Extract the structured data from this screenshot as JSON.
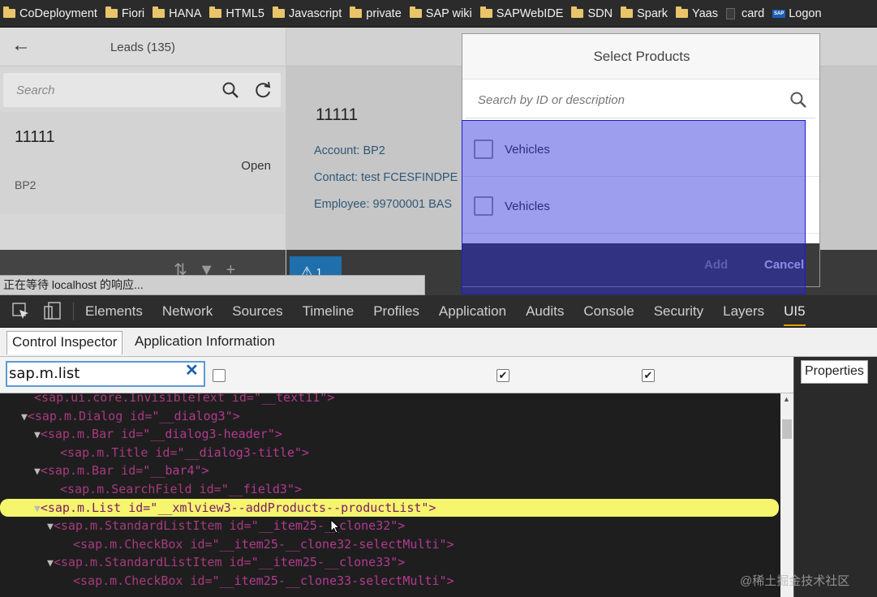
{
  "bookmarks": [
    {
      "label": "CoDeployment",
      "icon": "folder-icon"
    },
    {
      "label": "Fiori",
      "icon": "folder-icon"
    },
    {
      "label": "HANA",
      "icon": "folder-icon"
    },
    {
      "label": "HTML5",
      "icon": "folder-icon"
    },
    {
      "label": "Javascript",
      "icon": "folder-icon"
    },
    {
      "label": "private",
      "icon": "folder-icon"
    },
    {
      "label": "SAP wiki",
      "icon": "folder-icon"
    },
    {
      "label": "SAPWebIDE",
      "icon": "folder-icon"
    },
    {
      "label": "SDN",
      "icon": "folder-icon"
    },
    {
      "label": "Spark",
      "icon": "folder-icon"
    },
    {
      "label": "Yaas",
      "icon": "folder-icon"
    },
    {
      "label": "card",
      "icon": "page-icon"
    },
    {
      "label": "Logon",
      "icon": "sap-icon"
    }
  ],
  "master": {
    "title": "Leads (135)",
    "search_placeholder": "Search",
    "item": {
      "id": "11111",
      "status": "Open",
      "account": "BP2"
    }
  },
  "detail": {
    "id": "11111",
    "account": "Account: BP2",
    "contact": "Contact: test FCESFINDPE",
    "employee": "Employee: 99700001 BAS",
    "warn_count": "1"
  },
  "dialog": {
    "title": "Select Products",
    "search_placeholder": "Search by ID or description",
    "items": [
      {
        "label": "Vehicles"
      },
      {
        "label": "Vehicles"
      }
    ],
    "add_label": "Add",
    "cancel_label": "Cancel"
  },
  "status_bubble": "正在等待 localhost 的响应...",
  "devtools": {
    "tabs": [
      "Elements",
      "Network",
      "Sources",
      "Timeline",
      "Profiles",
      "Application",
      "Audits",
      "Console",
      "Security",
      "Layers",
      "UI5"
    ],
    "active_tab": "UI5",
    "subtabs": [
      "Control Inspector",
      "Application Information"
    ],
    "filter_value": "sap.m.list",
    "checkboxes": [
      false,
      true,
      true
    ],
    "properties_tab": "Properties",
    "tree": [
      {
        "indent": 3,
        "tri": "",
        "tag": "<sap.ui.core.InvisibleText",
        "attr": " id=",
        "val": "\"__text11\">"
      },
      {
        "indent": 2,
        "tri": "▼",
        "tag": "<sap.m.Dialog",
        "attr": " id=",
        "val": "\"__dialog3\">"
      },
      {
        "indent": 3,
        "tri": "▼",
        "tag": "<sap.m.Bar",
        "attr": " id=",
        "val": "\"__dialog3-header\">"
      },
      {
        "indent": 5,
        "tri": "",
        "tag": "<sap.m.Title",
        "attr": " id=",
        "val": "\"__dialog3-title\">"
      },
      {
        "indent": 3,
        "tri": "▼",
        "tag": "<sap.m.Bar",
        "attr": " id=",
        "val": "\"__bar4\">"
      },
      {
        "indent": 5,
        "tri": "",
        "tag": "<sap.m.SearchField",
        "attr": " id=",
        "val": "\"__field3\">"
      },
      {
        "indent": 3,
        "tri": "▼",
        "tag": "<sap.m.List",
        "attr": " id=",
        "val": "\"__xmlview3--addProducts--productList\">",
        "selected": true
      },
      {
        "indent": 4,
        "tri": "▼",
        "tag": "<sap.m.StandardListItem",
        "attr": " id=",
        "val": "\"__item25-__clone32\">"
      },
      {
        "indent": 6,
        "tri": "",
        "tag": "<sap.m.CheckBox",
        "attr": " id=",
        "val": "\"__item25-__clone32-selectMulti\">"
      },
      {
        "indent": 4,
        "tri": "▼",
        "tag": "<sap.m.StandardListItem",
        "attr": " id=",
        "val": "\"__item25-__clone33\">"
      },
      {
        "indent": 6,
        "tri": "",
        "tag": "<sap.m.CheckBox",
        "attr": " id=",
        "val": "\"__item25-__clone33-selectMulti\">"
      }
    ]
  },
  "watermark": "@稀土掘金技术社区"
}
